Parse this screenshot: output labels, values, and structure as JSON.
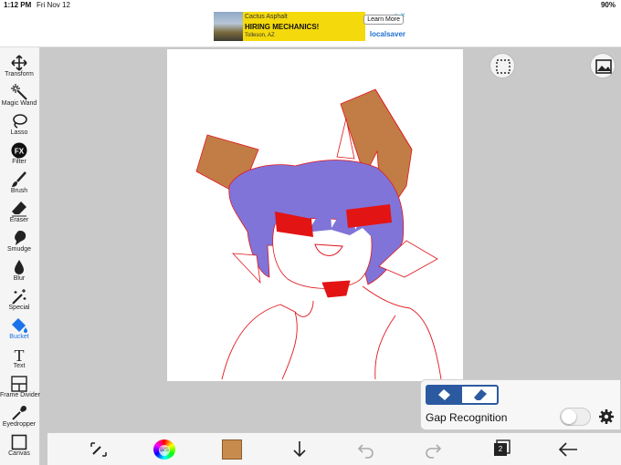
{
  "status_bar": {
    "time": "1:12 PM",
    "date": "Fri Nov 12",
    "battery": "90%"
  },
  "ad": {
    "company": "Cactus Asphalt",
    "headline": "HIRING MECHANICS!",
    "location": "Tolleson, AZ",
    "cta": "Learn More",
    "brand": "localsaver"
  },
  "tools": [
    {
      "label": "Transform",
      "icon": "transform-icon"
    },
    {
      "label": "Magic Wand",
      "icon": "magic-wand-icon"
    },
    {
      "label": "Lasso",
      "icon": "lasso-icon"
    },
    {
      "label": "Filter",
      "icon": "filter-icon"
    },
    {
      "label": "Brush",
      "icon": "brush-icon"
    },
    {
      "label": "Eraser",
      "icon": "eraser-icon"
    },
    {
      "label": "Smudge",
      "icon": "smudge-icon"
    },
    {
      "label": "Blur",
      "icon": "blur-icon"
    },
    {
      "label": "Special",
      "icon": "special-icon"
    },
    {
      "label": "Bucket",
      "icon": "bucket-icon",
      "active": true
    },
    {
      "label": "Text",
      "icon": "text-icon"
    },
    {
      "label": "Frame Divider",
      "icon": "frame-divider-icon"
    },
    {
      "label": "Eyedropper",
      "icon": "eyedropper-icon"
    },
    {
      "label": "Canvas",
      "icon": "canvas-icon"
    }
  ],
  "filter_glyph": "FX",
  "text_glyph": "T",
  "bucket_panel": {
    "gap_label": "Gap Recognition",
    "gap_enabled": false
  },
  "bottom": {
    "current_color": "#c88b4e",
    "layer_count": "2",
    "color_wheel_text": "B/S"
  },
  "colors": {
    "accent": "#1a73e8",
    "panel_blue": "#2c5aa0",
    "line_art": "#e0161c"
  }
}
